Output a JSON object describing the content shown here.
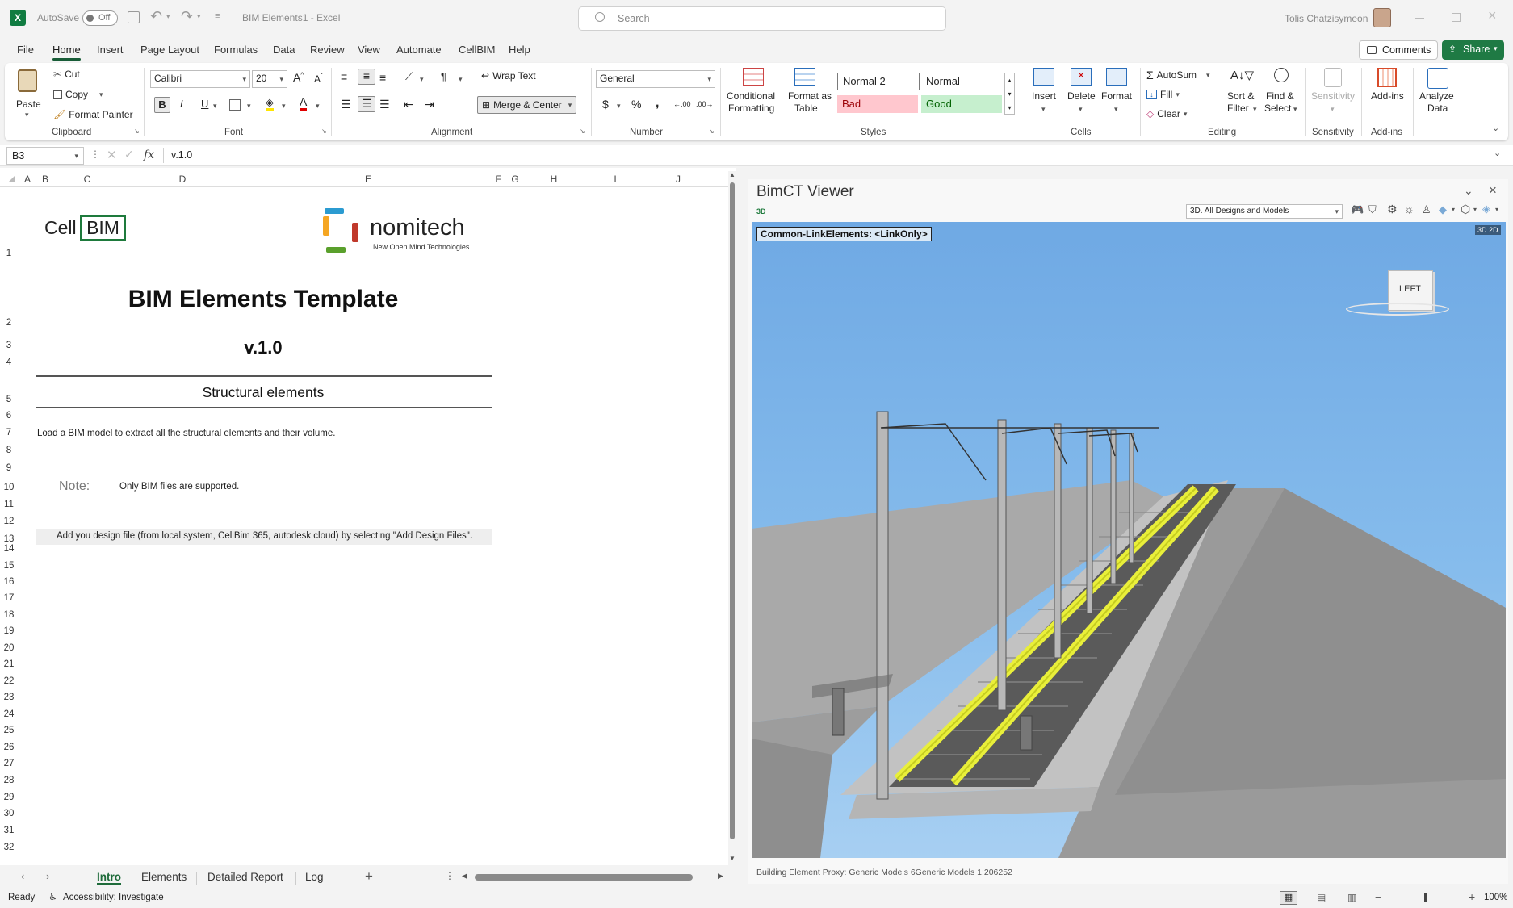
{
  "app": {
    "autosave_label": "AutoSave",
    "autosave_state": "Off",
    "doc_title": "BIM Elements1  -  Excel",
    "search_placeholder": "Search",
    "user_name": "Tolis Chatzisymeon"
  },
  "menu_tabs": [
    "File",
    "Home",
    "Insert",
    "Page Layout",
    "Formulas",
    "Data",
    "Review",
    "View",
    "Automate",
    "CellBIM",
    "Help"
  ],
  "menu_active": "Home",
  "comments_label": "Comments",
  "share_label": "Share",
  "ribbon": {
    "clipboard": {
      "paste": "Paste",
      "cut": "Cut",
      "copy": "Copy",
      "format_painter": "Format Painter",
      "label": "Clipboard"
    },
    "font": {
      "name": "Calibri",
      "size": "20",
      "label": "Font"
    },
    "alignment": {
      "wrap": "Wrap Text",
      "merge": "Merge & Center",
      "label": "Alignment"
    },
    "number": {
      "format": "General",
      "label": "Number"
    },
    "styles": {
      "cond_line1": "Conditional",
      "cond_line2": "Formatting",
      "table_line1": "Format as",
      "table_line2": "Table",
      "normal2": "Normal 2",
      "normal": "Normal",
      "bad": "Bad",
      "good": "Good",
      "label": "Styles"
    },
    "cells": {
      "insert": "Insert",
      "delete": "Delete",
      "format": "Format",
      "label": "Cells"
    },
    "editing": {
      "autosum": "AutoSum",
      "fill": "Fill",
      "clear": "Clear",
      "sort_line1": "Sort &",
      "sort_line2": "Filter",
      "find_line1": "Find &",
      "find_line2": "Select",
      "label": "Editing"
    },
    "sensitivity": {
      "btn": "Sensitivity",
      "label": "Sensitivity"
    },
    "addins": {
      "btn": "Add-ins",
      "label": "Add-ins"
    },
    "analyze": {
      "line1": "Analyze",
      "line2": "Data"
    }
  },
  "formula_bar": {
    "cell_ref": "B3",
    "fx": "fx",
    "value": "v.1.0"
  },
  "columns": [
    "A",
    "B",
    "C",
    "D",
    "E",
    "F",
    "G",
    "H",
    "I",
    "J"
  ],
  "rows": [
    "1",
    "2",
    "3",
    "4",
    "5",
    "6",
    "7",
    "8",
    "9",
    "10",
    "11",
    "12",
    "13",
    "14",
    "15",
    "16",
    "17",
    "18",
    "19",
    "20",
    "21",
    "22",
    "23",
    "24",
    "25",
    "26",
    "27",
    "28",
    "29",
    "30",
    "31",
    "32"
  ],
  "sheet": {
    "logo_cell": "Cell",
    "logo_bim": "BIM",
    "brand": "nomitech",
    "brand_tag": "New Open Mind Technologies",
    "title": "BIM Elements Template",
    "version": "v.1.0",
    "section": "Structural elements",
    "instruction": "Load a BIM model to extract all the structural elements and their volume.",
    "note_label": "Note:",
    "note_text": "Only BIM files are supported.",
    "hint": "Add you design file (from local system, CellBim 365, autodesk cloud) by selecting \"Add Design Files\"."
  },
  "sheet_tabs": [
    "Intro",
    "Elements",
    "Detailed Report",
    "Log"
  ],
  "sheet_tab_active": "Intro",
  "viewer": {
    "title": "BimCT Viewer",
    "mode": "3D",
    "view_select": "3D. All Designs and Models",
    "overlay_label": "Common-LinkElements: <LinkOnly>",
    "toggle": "3D 2D",
    "cube_face": "LEFT",
    "status": "Building Element Proxy: Generic Models 6Generic Models 1:206252"
  },
  "status": {
    "ready": "Ready",
    "accessibility": "Accessibility: Investigate",
    "zoom": "100%"
  },
  "colors": {
    "excel_green": "#185c37",
    "bad_bg": "#ffc7ce",
    "good_bg": "#c6efce",
    "sky": "#78b4e8",
    "rail": "#e9ef3a"
  }
}
